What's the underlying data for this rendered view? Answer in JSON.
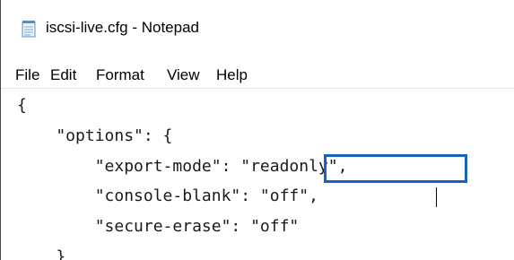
{
  "window": {
    "title": "iscsi-live.cfg - Notepad",
    "icon": "notepad-icon"
  },
  "menu": {
    "file": "File",
    "edit": "Edit",
    "format": "Format",
    "view": "View",
    "help": "Help"
  },
  "editor": {
    "lines": [
      "{",
      "    \"options\": {",
      "        \"export-mode\": \"readonly\",",
      "        \"console-blank\": \"off\",",
      "        \"secure-erase\": \"off\"",
      "    }"
    ],
    "highlighted_value": "\"readonly\"",
    "highlight_color": "#1565c0"
  }
}
